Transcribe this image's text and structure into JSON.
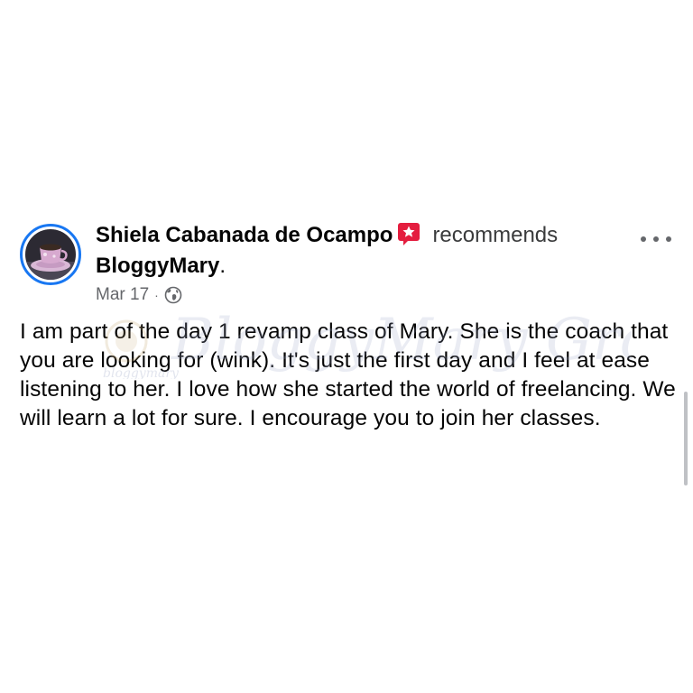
{
  "post": {
    "author": "Shiela Cabanada de Ocampo",
    "action": "recommends",
    "page_name": "BloggyMary",
    "page_suffix": ".",
    "date": "Mar 17",
    "separator": "·",
    "privacy_icon": "globe-icon",
    "badge_icon": "star-badge-icon",
    "badge_color": "#e41e3f",
    "body": "I am part of the day 1 revamp class of Mary. She is the coach that you are looking for (wink). It's just the first day and I feel at ease listening to her. I love how she started the world of freelancing. We will learn a lot for sure. I encourage you to join her classes.",
    "more_icon": "more-options-icon"
  },
  "watermark": {
    "text": "BloggyMary Group",
    "subtext": "bloggymary"
  },
  "colors": {
    "avatar_ring": "#1877f2",
    "meta_text": "#65676b"
  }
}
